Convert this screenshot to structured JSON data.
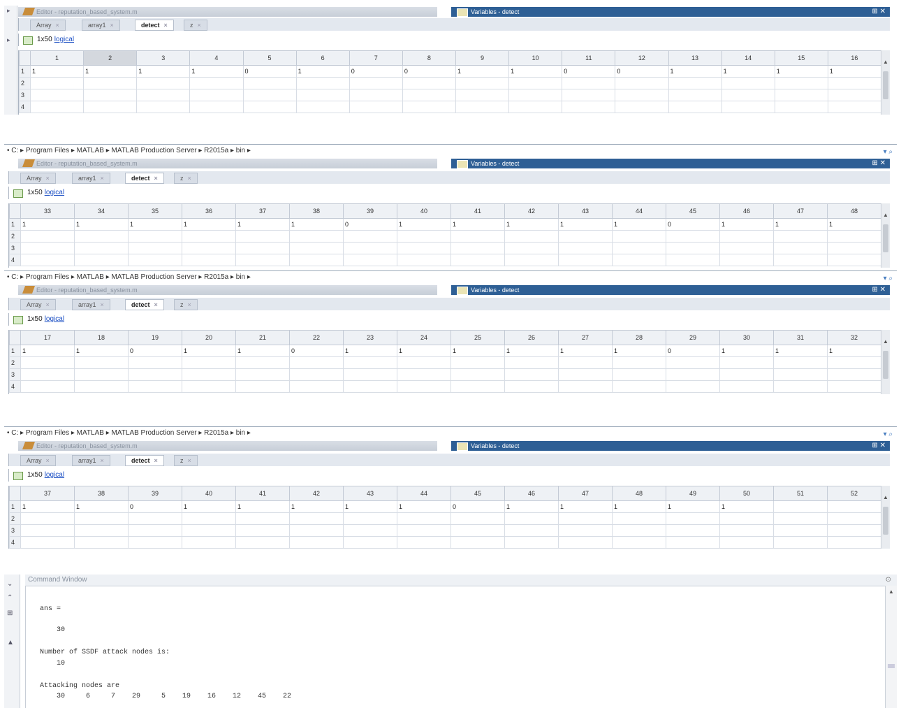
{
  "breadcrumb": "• C: ▸ Program Files ▸ MATLAB ▸ MATLAB Production Server ▸ R2015a ▸ bin ▸",
  "editor_title": "Editor - reputation_based_system.m",
  "variables_title": "Variables - detect",
  "window_buttons": "⊞ ✕",
  "tabs": [
    "Array",
    "array1",
    "detect",
    "z"
  ],
  "tab_close": "×",
  "size_label": "1x50",
  "class_label": "logical",
  "row_numbers": [
    "1",
    "2",
    "3",
    "4"
  ],
  "panels": [
    {
      "cols": [
        "1",
        "2",
        "3",
        "4",
        "5",
        "6",
        "7",
        "8",
        "9",
        "10",
        "11",
        "12",
        "13",
        "14",
        "15",
        "16"
      ],
      "values": [
        "1",
        "1",
        "1",
        "1",
        "0",
        "1",
        "0",
        "0",
        "1",
        "1",
        "0",
        "0",
        "1",
        "1",
        "1",
        "1"
      ]
    },
    {
      "cols": [
        "33",
        "34",
        "35",
        "36",
        "37",
        "38",
        "39",
        "40",
        "41",
        "42",
        "43",
        "44",
        "45",
        "46",
        "47",
        "48"
      ],
      "values": [
        "1",
        "1",
        "1",
        "1",
        "1",
        "1",
        "0",
        "1",
        "1",
        "1",
        "1",
        "1",
        "0",
        "1",
        "1",
        "1"
      ]
    },
    {
      "cols": [
        "17",
        "18",
        "19",
        "20",
        "21",
        "22",
        "23",
        "24",
        "25",
        "26",
        "27",
        "28",
        "29",
        "30",
        "31",
        "32"
      ],
      "values": [
        "1",
        "1",
        "0",
        "1",
        "1",
        "0",
        "1",
        "1",
        "1",
        "1",
        "1",
        "1",
        "0",
        "1",
        "1",
        "1"
      ]
    },
    {
      "cols": [
        "37",
        "38",
        "39",
        "40",
        "41",
        "42",
        "43",
        "44",
        "45",
        "46",
        "47",
        "48",
        "49",
        "50",
        "51",
        "52"
      ],
      "values": [
        "1",
        "1",
        "0",
        "1",
        "1",
        "1",
        "1",
        "1",
        "0",
        "1",
        "1",
        "1",
        "1",
        "1",
        "",
        ""
      ]
    }
  ],
  "command_window": {
    "title": "Command Window",
    "lines": [
      "ans =",
      "    30",
      "Number of SSDF attack nodes is:",
      "    10",
      "Attacking nodes are",
      "    30     6     7    29     5    19    16    12    45    22"
    ]
  }
}
